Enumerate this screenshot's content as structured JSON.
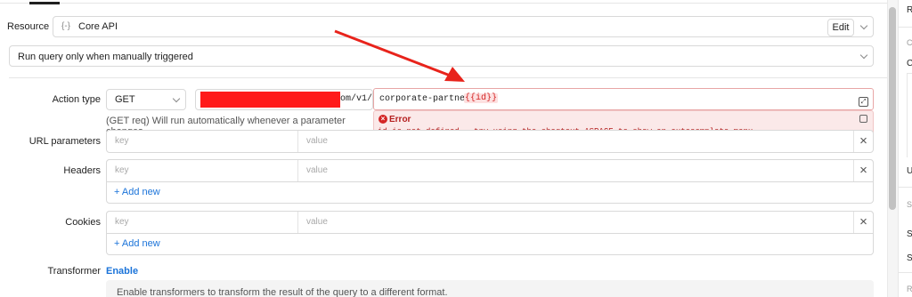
{
  "resource": {
    "label": "Resource",
    "icon": "api-braces-icon",
    "icon_glyph": "{-}",
    "value": "Core API",
    "edit_label": "Edit"
  },
  "trigger": {
    "value": "Run query only when manually triggered"
  },
  "action": {
    "label": "Action type",
    "method": "GET",
    "url_suffix": "om/v1/",
    "path_prefix": "corporate-partners/",
    "path_template": "{{id}}",
    "helper_text": "(GET req) Will run automatically whenever a parameter changes."
  },
  "error": {
    "title": "Error",
    "message": "id is not defined - try using the shortcut ^SPACE to show an autocomplete menu."
  },
  "url_parameters": {
    "label": "URL parameters",
    "key_placeholder": "key",
    "value_placeholder": "value"
  },
  "headers": {
    "label": "Headers",
    "key_placeholder": "key",
    "value_placeholder": "value",
    "add_new": "+ Add new"
  },
  "cookies": {
    "label": "Cookies",
    "key_placeholder": "key",
    "value_placeholder": "value",
    "add_new": "+ Add new"
  },
  "transformer": {
    "label": "Transformer",
    "enable_label": "Enable",
    "description": "Enable transformers to transform the result of the query to a different format."
  },
  "right_panel": {
    "letters": [
      "R",
      "C",
      "C",
      "U",
      "S",
      "S",
      "S",
      "R"
    ]
  },
  "colors": {
    "accent_link": "#1a73d9",
    "error_red": "#d42626",
    "error_bg": "#fbe9e9",
    "annotation_arrow": "#e8231b",
    "redaction": "#ff1a1a"
  }
}
